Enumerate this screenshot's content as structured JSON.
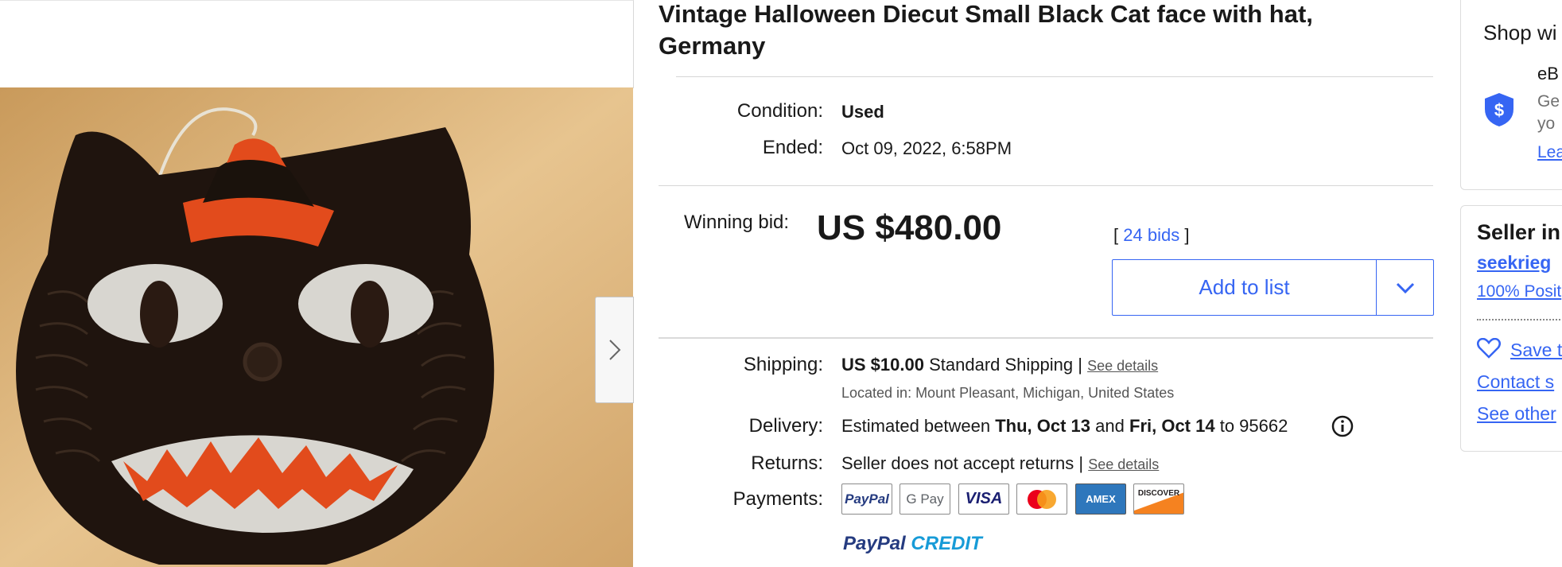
{
  "item": {
    "title": "Vintage Halloween Diecut Small Black Cat face with hat, Germany",
    "condition_label": "Condition:",
    "condition_value": "Used",
    "ended_label": "Ended:",
    "ended_value": "Oct 09, 2022, 6:58PM"
  },
  "bid": {
    "label": "Winning bid:",
    "price": "US $480.00",
    "bids_open": "[",
    "bids_link": "24 bids",
    "bids_close": "]",
    "add_to_list": "Add to list"
  },
  "shipping": {
    "label": "Shipping:",
    "price": "US $10.00",
    "method": "Standard Shipping |",
    "see_details": "See details",
    "location": "Located in: Mount Pleasant, Michigan, United States"
  },
  "delivery": {
    "label": "Delivery:",
    "prefix": "Estimated between",
    "from": "Thu, Oct 13",
    "and": "and",
    "to_date": "Fri, Oct 14",
    "suffix": "to 95662"
  },
  "returns": {
    "label": "Returns:",
    "text": "Seller does not accept returns |",
    "see_details": "See details"
  },
  "payments": {
    "label": "Payments:",
    "methods": [
      "PayPal",
      "G Pay",
      "VISA",
      "",
      "AMEX",
      "DISCOVER"
    ],
    "paypal_credit_1": "PayPal",
    "paypal_credit_2": "CREDIT"
  },
  "rail": {
    "shop_title": "Shop wi",
    "ebay_line": "eB",
    "ge_line": "Ge",
    "yo_line": "yo",
    "learn_link": "Lea",
    "seller_title": "Seller in",
    "seller_name": "seekrieg",
    "positive": "100% Posit",
    "save_seller": "Save t",
    "contact": "Contact s",
    "see_other": "See other"
  },
  "colors": {
    "link": "#3665f3",
    "text": "#191919",
    "price": "#191919"
  }
}
